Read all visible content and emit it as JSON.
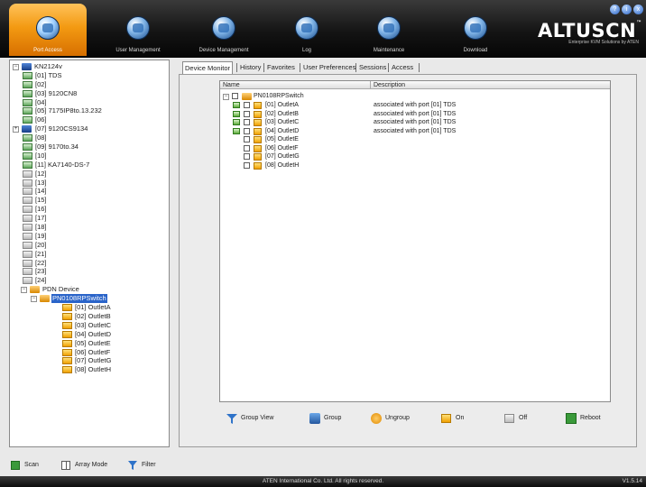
{
  "nav": {
    "tabs": [
      {
        "label": "Port Access",
        "icon": "port-access-icon"
      },
      {
        "label": "User Management",
        "icon": "user-management-icon"
      },
      {
        "label": "Device Management",
        "icon": "device-management-icon"
      },
      {
        "label": "Log",
        "icon": "log-icon"
      },
      {
        "label": "Maintenance",
        "icon": "maintenance-icon"
      },
      {
        "label": "Download",
        "icon": "download-icon"
      }
    ],
    "active": "Port Access"
  },
  "logo": {
    "brand": "ALTUSCN",
    "tm": "™",
    "tagline": "Enterprise KVM Solutions by ATEN"
  },
  "window_controls": [
    "?",
    "i",
    "x"
  ],
  "tree": {
    "root": "KN2124v",
    "ports": [
      {
        "label": "[01] TDS",
        "active": true
      },
      {
        "label": "[02]",
        "active": true
      },
      {
        "label": "[03] 9120CN8",
        "active": true
      },
      {
        "label": "[04]",
        "active": true
      },
      {
        "label": "[05] 7175IP8to.13.232",
        "active": true
      },
      {
        "label": "[06]",
        "active": true
      },
      {
        "label": "[07] 9120CS9134",
        "active": true,
        "expandable": true
      },
      {
        "label": "[08]",
        "active": true
      },
      {
        "label": "[09] 9170to.34",
        "active": true
      },
      {
        "label": "[10]",
        "active": true
      },
      {
        "label": "[11] KA7140-DS-7",
        "active": true
      },
      {
        "label": "[12]",
        "active": false
      },
      {
        "label": "[13]",
        "active": false
      },
      {
        "label": "[14]",
        "active": false
      },
      {
        "label": "[15]",
        "active": false
      },
      {
        "label": "[16]",
        "active": false
      },
      {
        "label": "[17]",
        "active": false
      },
      {
        "label": "[18]",
        "active": false
      },
      {
        "label": "[19]",
        "active": false
      },
      {
        "label": "[20]",
        "active": false
      },
      {
        "label": "[21]",
        "active": false
      },
      {
        "label": "[22]",
        "active": false
      },
      {
        "label": "[23]",
        "active": false
      },
      {
        "label": "[24]",
        "active": false
      }
    ],
    "pdu_group": "PDN Device",
    "pdu_switch": "PN0108RPSwitch",
    "outlets": [
      "[01] OutletA",
      "[02] OutletB",
      "[03] OutletC",
      "[04] OutletD",
      "[05] OutletE",
      "[06] OutletF",
      "[07] OutletG",
      "[08] OutletH"
    ]
  },
  "left_tools": {
    "scan": "Scan",
    "array_mode": "Array Mode",
    "filter": "Filter"
  },
  "tabs": [
    "Device Monitor",
    "History",
    "Favorites",
    "User Preferences",
    "Sessions",
    "Access"
  ],
  "active_tab": "Device Monitor",
  "grid": {
    "columns": [
      "Name",
      "Description"
    ],
    "switch_row": "PN0108RPSwitch",
    "rows": [
      {
        "name": "[01] OutletA",
        "description": "associated with port [01] TDS",
        "on": true
      },
      {
        "name": "[02] OutletB",
        "description": "associated with port [01] TDS",
        "on": true
      },
      {
        "name": "[03] OutletC",
        "description": "associated with port [01] TDS",
        "on": true
      },
      {
        "name": "[04] OutletD",
        "description": "associated with port [01] TDS",
        "on": true
      },
      {
        "name": "[05] OutletE",
        "description": "",
        "on": false
      },
      {
        "name": "[06] OutletF",
        "description": "",
        "on": false
      },
      {
        "name": "[07] OutletG",
        "description": "",
        "on": false
      },
      {
        "name": "[08] OutletH",
        "description": "",
        "on": false
      }
    ]
  },
  "actions": {
    "group_view": "Group View",
    "group": "Group",
    "ungroup": "Ungroup",
    "on": "On",
    "off": "Off",
    "reboot": "Reboot"
  },
  "status": {
    "copyright": "ATEN International Co. Ltd. All rights reserved.",
    "version": "V1.5.14"
  },
  "colors": {
    "accent": "#f39a12",
    "selection": "#2a64c9",
    "topbar": "#141414"
  }
}
